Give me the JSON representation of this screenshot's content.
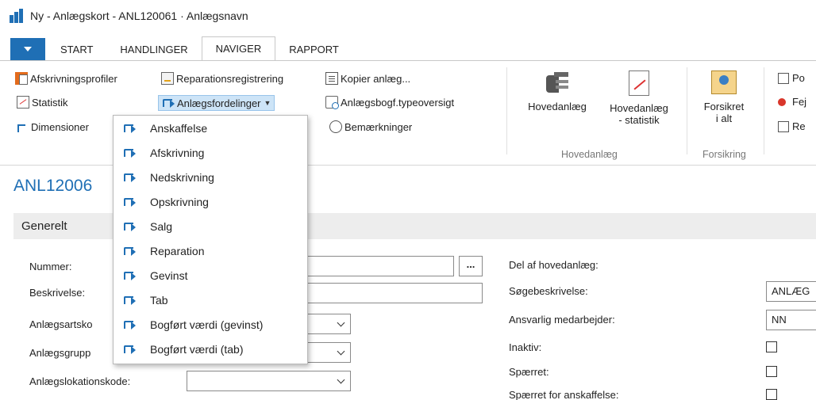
{
  "window": {
    "title": "Ny - Anlægskort - ANL120061 · Anlægsnavn"
  },
  "tabs": [
    {
      "label": "START"
    },
    {
      "label": "HANDLINGER"
    },
    {
      "label": "NAVIGER",
      "active": true
    },
    {
      "label": "RAPPORT"
    }
  ],
  "ribbon": {
    "col1": [
      {
        "label": "Afskrivningsprofiler",
        "icon": "depreciation-book-icon"
      },
      {
        "label": "Statistik",
        "icon": "statistics-icon"
      },
      {
        "label": "Dimensioner",
        "icon": "dimensions-icon"
      }
    ],
    "col2": [
      {
        "label": "Reparationsregistrering",
        "icon": "repair-register-icon"
      },
      {
        "label": "Anlægsfordelinger",
        "icon": "allocation-icon",
        "dropdown": true
      }
    ],
    "col3": [
      {
        "label": "Kopier anlæg...",
        "icon": "copy-asset-icon"
      },
      {
        "label": "Anlægsbogf.typeoversigt",
        "icon": "posting-type-overview-icon"
      },
      {
        "label": "Bemærkninger",
        "icon": "comments-icon"
      }
    ],
    "group_hovedanlaeg": {
      "label": "Hovedanlæg",
      "btn1": {
        "label": "Hovedanlæg",
        "icon": "main-asset-icon"
      },
      "btn2": {
        "line1": "Hovedanlæg",
        "line2": "- statistik",
        "icon": "main-asset-statistics-icon"
      }
    },
    "group_forsikring": {
      "label": "Forsikring",
      "btn1": {
        "line1": "Forsikret",
        "line2": "i alt",
        "icon": "insured-total-icon"
      }
    },
    "col_right": [
      {
        "label": "Po"
      },
      {
        "label": "Fej"
      },
      {
        "label": "Re"
      }
    ]
  },
  "page": {
    "title": "ANL12006",
    "section": "Generelt"
  },
  "fields_left": [
    {
      "label": "Nummer:"
    },
    {
      "label": "Beskrivelse:"
    },
    {
      "label": "Anlægsartsko"
    },
    {
      "label": "Anlægsgrupp"
    },
    {
      "label": "Anlægslokationskode:"
    }
  ],
  "fields_right": {
    "hovedanlaeg_label": "Del af hovedanlæg:",
    "soege_label": "Søgebeskrivelse:",
    "soege_value": "ANLÆG",
    "ansvarlig_label": "Ansvarlig medarbejder:",
    "ansvarlig_value": "NN",
    "inaktiv_label": "Inaktiv:",
    "spaerret_label": "Spærret:",
    "spaerret_anskaf_label": "Spærret for anskaffelse:"
  },
  "ellipsis_label": "...",
  "dropdown_menu": [
    {
      "label": "Anskaffelse"
    },
    {
      "label": "Afskrivning"
    },
    {
      "label": "Nedskrivning"
    },
    {
      "label": "Opskrivning"
    },
    {
      "label": "Salg"
    },
    {
      "label": "Reparation"
    },
    {
      "label": "Gevinst"
    },
    {
      "label": "Tab"
    },
    {
      "label": "Bogført værdi (gevinst)"
    },
    {
      "label": "Bogført værdi (tab)"
    }
  ],
  "colors": {
    "accent": "#1f6fb5",
    "section_bg": "#ededed",
    "hover": "#cde4f7"
  }
}
